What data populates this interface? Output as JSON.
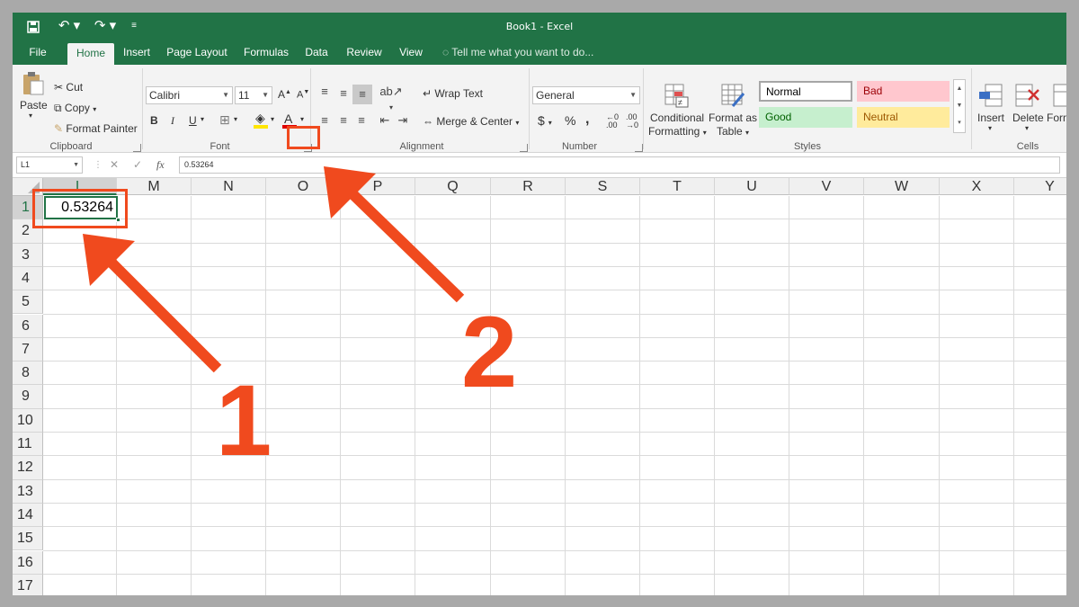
{
  "window": {
    "title": "Book1 - Excel"
  },
  "quick_access": {
    "save_icon": "save-icon",
    "undo_icon": "undo-icon",
    "redo_icon": "redo-icon",
    "customize_icon": "customize-icon"
  },
  "menu": {
    "tabs": [
      "File",
      "Home",
      "Insert",
      "Page Layout",
      "Formulas",
      "Data",
      "Review",
      "View"
    ],
    "active": "Home",
    "tell_me": "Tell me what you want to do..."
  },
  "ribbon": {
    "clipboard": {
      "paste": "Paste",
      "cut": "Cut",
      "copy": "Copy",
      "format_painter": "Format Painter",
      "label": "Clipboard"
    },
    "font": {
      "name": "Calibri",
      "size": "11",
      "bold": "B",
      "italic": "I",
      "underline": "U",
      "grow": "A",
      "shrink": "A",
      "color": "A",
      "label": "Font"
    },
    "alignment": {
      "wrap_text": "Wrap Text",
      "merge_center": "Merge & Center",
      "label": "Alignment"
    },
    "number": {
      "format": "General",
      "currency": "$",
      "percent": "%",
      "comma": ",",
      "label": "Number"
    },
    "styles": {
      "conditional_1": "Conditional",
      "conditional_2": "Formatting",
      "table_1": "Format as",
      "table_2": "Table",
      "normal": "Normal",
      "bad": "Bad",
      "good": "Good",
      "neutral": "Neutral",
      "label": "Styles"
    },
    "cells": {
      "insert": "Insert",
      "delete": "Delete",
      "format": "Form",
      "label": "Cells"
    }
  },
  "formula_bar": {
    "name_box": "L1",
    "value": "0.53264",
    "fx": "fx"
  },
  "grid": {
    "columns": [
      "L",
      "M",
      "N",
      "O",
      "P",
      "Q",
      "R",
      "S",
      "T",
      "U",
      "V",
      "W",
      "X",
      "Y"
    ],
    "rows": [
      "1",
      "2",
      "3",
      "4",
      "5",
      "6",
      "7",
      "8",
      "9",
      "10",
      "11",
      "12",
      "13",
      "14",
      "15",
      "16",
      "17"
    ],
    "active_cell_value": "0.53264"
  },
  "annotations": {
    "label_1": "1",
    "label_2": "2",
    "color": "#f04a1e"
  }
}
